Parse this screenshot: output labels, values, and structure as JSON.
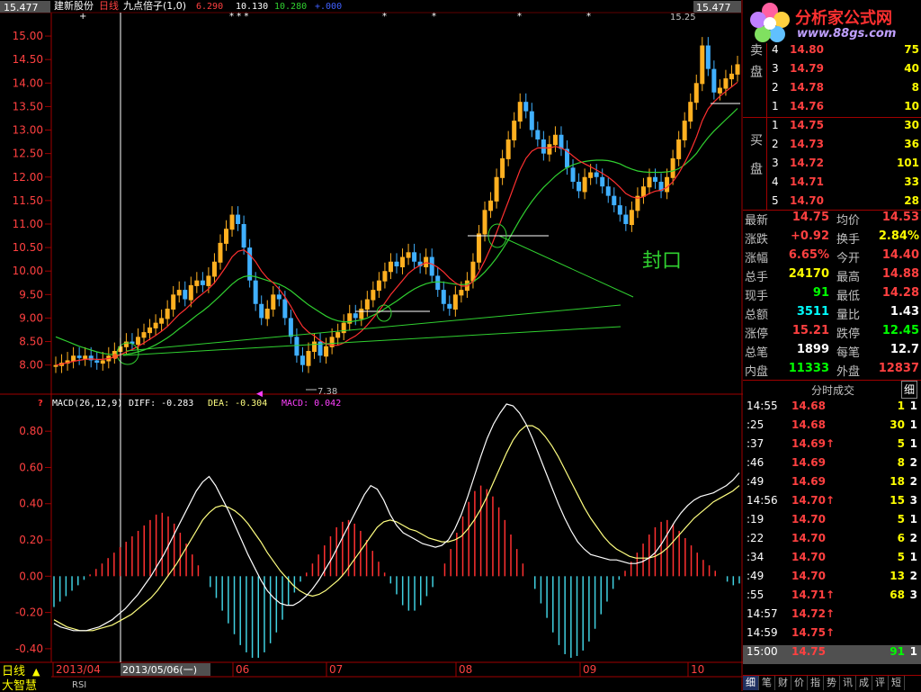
{
  "header": {
    "stock_name": "建新股份",
    "indicator_label": "日线",
    "formula_label": "九点倍子(1,0)",
    "val1": "6.290",
    "val2": "10.130",
    "val3": "10.280",
    "val4": "+.000",
    "top_price_left": "15.477",
    "top_price_right": "15.477",
    "peak_label": "15.25",
    "low_label": "7.38"
  },
  "logo": {
    "title": "分析家公式网",
    "url": "www.88gs.com"
  },
  "annotation": {
    "seal_text": "封口"
  },
  "macd_header": {
    "label": "MACD(26,12,9)",
    "diff": "DIFF: -0.283",
    "dea": "DEA: -0.304",
    "macd": "MACD: 0.042"
  },
  "chart_data": [
    {
      "type": "candlestick",
      "title": "",
      "y_ticks": [
        "15.00",
        "14.50",
        "14.00",
        "13.50",
        "13.00",
        "12.50",
        "12.00",
        "11.50",
        "11.00",
        "10.50",
        "10.00",
        "9.50",
        "9.00",
        "8.50",
        "8.00"
      ],
      "ylim": [
        7.4,
        15.48
      ],
      "x_ticks": [
        "2013/04",
        "06",
        "07",
        "08",
        "09",
        "10"
      ],
      "cursor_date": "2013/05/06(一)",
      "colors": {
        "up": "#ffb020",
        "down": "#40b0ff",
        "ma_short": "#ff3030",
        "ma_long": "#30d030"
      },
      "closes": [
        8.0,
        8.05,
        8.1,
        8.2,
        8.15,
        8.2,
        8.1,
        8.05,
        8.1,
        8.2,
        8.3,
        8.4,
        8.5,
        8.45,
        8.6,
        8.7,
        8.8,
        8.9,
        9.0,
        9.2,
        9.5,
        9.6,
        9.4,
        9.7,
        9.8,
        9.7,
        9.9,
        10.2,
        10.6,
        10.9,
        11.2,
        11.0,
        10.5,
        9.8,
        9.3,
        9.0,
        9.2,
        9.5,
        9.4,
        9.0,
        8.6,
        8.2,
        8.0,
        8.3,
        8.5,
        8.2,
        8.4,
        8.6,
        8.7,
        8.9,
        9.1,
        9.0,
        9.2,
        9.4,
        9.6,
        9.8,
        10.0,
        10.2,
        10.1,
        10.3,
        10.4,
        10.2,
        10.1,
        10.3,
        9.9,
        9.6,
        9.3,
        9.2,
        9.5,
        9.6,
        9.8,
        10.2,
        10.8,
        11.3,
        11.5,
        12.0,
        12.4,
        12.8,
        13.2,
        13.6,
        13.4,
        13.0,
        12.8,
        12.5,
        12.7,
        12.9,
        12.6,
        12.2,
        11.9,
        11.7,
        12.0,
        12.1,
        12.0,
        11.8,
        11.6,
        11.4,
        11.2,
        11.0,
        11.3,
        11.6,
        11.8,
        12.0,
        11.9,
        11.7,
        12.0,
        12.4,
        12.8,
        13.2,
        13.6,
        14.0,
        14.8,
        14.3,
        13.8,
        13.9,
        14.1,
        14.2,
        14.4
      ],
      "ma_short": [
        8.0,
        8.02,
        8.05,
        8.08,
        8.1,
        8.12,
        8.13,
        8.12,
        8.12,
        8.14,
        8.17,
        8.22,
        8.28,
        8.33,
        8.4,
        8.47,
        8.55,
        8.63,
        8.72,
        8.82,
        8.95,
        9.08,
        9.18,
        9.3,
        9.42,
        9.52,
        9.62,
        9.75,
        9.92,
        10.1,
        10.3,
        10.42,
        10.45,
        10.35,
        10.2,
        10.0,
        9.85,
        9.75,
        9.62,
        9.45,
        9.25,
        9.02,
        8.82,
        8.7,
        8.62,
        8.52,
        8.45,
        8.42,
        8.42,
        8.47,
        8.55,
        8.62,
        8.72,
        8.85,
        9.0,
        9.15,
        9.32,
        9.5,
        9.65,
        9.8,
        9.95,
        10.05,
        10.12,
        10.18,
        10.15,
        10.08,
        9.98,
        9.85,
        9.75,
        9.68,
        9.68,
        9.78,
        9.98,
        10.22,
        10.5,
        10.82,
        11.15,
        11.48,
        11.82,
        12.15,
        12.4,
        12.55,
        12.62,
        12.62,
        12.62,
        12.65,
        12.62,
        12.55,
        12.45,
        12.35,
        12.28,
        12.22,
        12.15,
        12.08,
        12.0,
        11.9,
        11.78,
        11.65,
        11.58,
        11.55,
        11.58,
        11.65,
        11.7,
        11.72,
        11.78,
        11.9,
        12.08,
        12.3,
        12.55,
        12.85,
        13.2,
        13.45,
        13.6,
        13.72,
        13.82,
        13.92,
        14.02
      ],
      "ma_long": [
        8.6,
        8.55,
        8.5,
        8.45,
        8.4,
        8.36,
        8.32,
        8.28,
        8.25,
        8.23,
        8.22,
        8.22,
        8.23,
        8.25,
        8.28,
        8.32,
        8.37,
        8.43,
        8.5,
        8.58,
        8.67,
        8.77,
        8.86,
        8.96,
        9.06,
        9.15,
        9.25,
        9.36,
        9.48,
        9.6,
        9.72,
        9.82,
        9.88,
        9.9,
        9.88,
        9.84,
        9.8,
        9.76,
        9.72,
        9.66,
        9.58,
        9.48,
        9.38,
        9.28,
        9.2,
        9.12,
        9.04,
        8.98,
        8.94,
        8.92,
        8.92,
        8.94,
        8.96,
        9.0,
        9.06,
        9.12,
        9.2,
        9.28,
        9.36,
        9.45,
        9.54,
        9.62,
        9.68,
        9.73,
        9.76,
        9.77,
        9.76,
        9.74,
        9.72,
        9.71,
        9.72,
        9.77,
        9.86,
        9.98,
        10.12,
        10.28,
        10.46,
        10.66,
        10.88,
        11.1,
        11.3,
        11.48,
        11.64,
        11.78,
        11.9,
        12.02,
        12.12,
        12.2,
        12.26,
        12.3,
        12.33,
        12.35,
        12.36,
        12.36,
        12.35,
        12.32,
        12.28,
        12.22,
        12.17,
        12.13,
        12.11,
        12.1,
        12.1,
        12.1,
        12.11,
        12.13,
        12.18,
        12.26,
        12.37,
        12.5,
        12.68,
        12.84,
        12.98,
        13.1,
        13.22,
        13.34,
        13.46
      ]
    },
    {
      "type": "bar+line",
      "title": "MACD(26,12,9)",
      "y_ticks": [
        "0.80",
        "0.60",
        "0.40",
        "0.20",
        "0.00",
        "-0.20",
        "-0.40"
      ],
      "ylim": [
        -0.47,
        0.92
      ],
      "colors": {
        "pos": "#ff3030",
        "neg": "#40d0e0",
        "diff": "#ffffff",
        "dea": "#ffff80"
      },
      "histogram": [
        -0.17,
        -0.14,
        -0.11,
        -0.08,
        -0.05,
        -0.02,
        0.01,
        0.04,
        0.07,
        0.1,
        0.13,
        0.16,
        0.19,
        0.22,
        0.25,
        0.28,
        0.31,
        0.34,
        0.35,
        0.33,
        0.29,
        0.24,
        0.18,
        0.12,
        0.06,
        0.0,
        -0.06,
        -0.12,
        -0.19,
        -0.26,
        -0.32,
        -0.38,
        -0.42,
        -0.45,
        -0.45,
        -0.42,
        -0.37,
        -0.31,
        -0.24,
        -0.16,
        -0.09,
        -0.03,
        0.02,
        0.07,
        0.12,
        0.17,
        0.22,
        0.27,
        0.3,
        0.31,
        0.29,
        0.25,
        0.2,
        0.14,
        0.08,
        0.02,
        -0.04,
        -0.1,
        -0.16,
        -0.19,
        -0.19,
        -0.16,
        -0.11,
        -0.06,
        0.0,
        0.07,
        0.15,
        0.24,
        0.33,
        0.41,
        0.47,
        0.5,
        0.48,
        0.44,
        0.38,
        0.31,
        0.23,
        0.15,
        0.07,
        0.0,
        -0.07,
        -0.15,
        -0.23,
        -0.31,
        -0.38,
        -0.43,
        -0.45,
        -0.44,
        -0.41,
        -0.36,
        -0.29,
        -0.21,
        -0.14,
        -0.07,
        -0.02,
        0.03,
        0.08,
        0.13,
        0.18,
        0.23,
        0.27,
        0.3,
        0.31,
        0.29,
        0.25,
        0.21,
        0.17,
        0.13,
        0.09,
        0.06,
        0.03,
        0.0,
        -0.03,
        -0.05,
        -0.04
      ],
      "diff": [
        -0.26,
        -0.28,
        -0.29,
        -0.3,
        -0.3,
        -0.3,
        -0.29,
        -0.28,
        -0.26,
        -0.24,
        -0.21,
        -0.18,
        -0.14,
        -0.1,
        -0.05,
        0.0,
        0.06,
        0.12,
        0.19,
        0.26,
        0.33,
        0.4,
        0.47,
        0.52,
        0.55,
        0.5,
        0.43,
        0.36,
        0.28,
        0.2,
        0.12,
        0.05,
        -0.02,
        -0.08,
        -0.12,
        -0.15,
        -0.16,
        -0.16,
        -0.14,
        -0.11,
        -0.07,
        -0.02,
        0.04,
        0.1,
        0.17,
        0.24,
        0.31,
        0.38,
        0.45,
        0.5,
        0.48,
        0.42,
        0.34,
        0.28,
        0.24,
        0.22,
        0.2,
        0.18,
        0.17,
        0.16,
        0.17,
        0.2,
        0.26,
        0.34,
        0.44,
        0.55,
        0.66,
        0.76,
        0.84,
        0.9,
        0.95,
        0.94,
        0.9,
        0.84,
        0.76,
        0.67,
        0.58,
        0.49,
        0.4,
        0.32,
        0.25,
        0.19,
        0.15,
        0.12,
        0.11,
        0.1,
        0.09,
        0.09,
        0.08,
        0.07,
        0.07,
        0.08,
        0.1,
        0.13,
        0.18,
        0.24,
        0.3,
        0.35,
        0.39,
        0.42,
        0.44,
        0.45,
        0.46,
        0.48,
        0.5,
        0.53,
        0.57
      ],
      "dea": [
        -0.24,
        -0.26,
        -0.28,
        -0.29,
        -0.3,
        -0.3,
        -0.3,
        -0.29,
        -0.28,
        -0.27,
        -0.25,
        -0.23,
        -0.21,
        -0.18,
        -0.15,
        -0.12,
        -0.08,
        -0.03,
        0.02,
        0.07,
        0.13,
        0.19,
        0.25,
        0.31,
        0.35,
        0.38,
        0.39,
        0.38,
        0.36,
        0.33,
        0.29,
        0.24,
        0.19,
        0.13,
        0.08,
        0.03,
        -0.01,
        -0.05,
        -0.08,
        -0.1,
        -0.11,
        -0.1,
        -0.08,
        -0.05,
        -0.02,
        0.02,
        0.07,
        0.12,
        0.17,
        0.22,
        0.27,
        0.3,
        0.31,
        0.3,
        0.28,
        0.26,
        0.25,
        0.23,
        0.21,
        0.2,
        0.19,
        0.19,
        0.2,
        0.22,
        0.26,
        0.31,
        0.37,
        0.44,
        0.52,
        0.6,
        0.68,
        0.75,
        0.8,
        0.83,
        0.83,
        0.81,
        0.77,
        0.72,
        0.66,
        0.59,
        0.52,
        0.45,
        0.38,
        0.32,
        0.27,
        0.22,
        0.18,
        0.15,
        0.13,
        0.11,
        0.1,
        0.1,
        0.1,
        0.11,
        0.13,
        0.16,
        0.2,
        0.24,
        0.28,
        0.32,
        0.35,
        0.38,
        0.41,
        0.43,
        0.45,
        0.47,
        0.5
      ]
    }
  ],
  "order_book": {
    "sell_label": "卖盘",
    "buy_label": "买盘",
    "sells": [
      {
        "idx": "4",
        "price": "14.80",
        "vol": "75"
      },
      {
        "idx": "3",
        "price": "14.79",
        "vol": "40"
      },
      {
        "idx": "2",
        "price": "14.78",
        "vol": "8"
      },
      {
        "idx": "1",
        "price": "14.76",
        "vol": "10"
      }
    ],
    "buys": [
      {
        "idx": "1",
        "price": "14.75",
        "vol": "30"
      },
      {
        "idx": "2",
        "price": "14.73",
        "vol": "36"
      },
      {
        "idx": "3",
        "price": "14.72",
        "vol": "101"
      },
      {
        "idx": "4",
        "price": "14.71",
        "vol": "33"
      },
      {
        "idx": "5",
        "price": "14.70",
        "vol": "28"
      }
    ]
  },
  "quote": [
    {
      "l": "最新",
      "v": "14.75",
      "vc": "#ff4040",
      "l2": "均价",
      "v2": "14.53",
      "v2c": "#ff4040"
    },
    {
      "l": "涨跌",
      "v": "+0.92",
      "vc": "#ff4040",
      "l2": "换手",
      "v2": "2.84%",
      "v2c": "#ffff00"
    },
    {
      "l": "涨幅",
      "v": "6.65%",
      "vc": "#ff4040",
      "l2": "今开",
      "v2": "14.40",
      "v2c": "#ff4040"
    },
    {
      "l": "总手",
      "v": "24170",
      "vc": "#ffff00",
      "l2": "最高",
      "v2": "14.88",
      "v2c": "#ff4040"
    },
    {
      "l": "现手",
      "v": "91",
      "vc": "#00ff00",
      "l2": "最低",
      "v2": "14.28",
      "v2c": "#ff4040"
    },
    {
      "l": "总额",
      "v": "3511",
      "vc": "#00ffff",
      "l2": "量比",
      "v2": "1.43",
      "v2c": "#ffffff"
    },
    {
      "l": "涨停",
      "v": "15.21",
      "vc": "#ff4040",
      "l2": "跌停",
      "v2": "12.45",
      "v2c": "#00ff00"
    },
    {
      "l": "总笔",
      "v": "1899",
      "vc": "#ffffff",
      "l2": "每笔",
      "v2": "12.7",
      "v2c": "#ffffff"
    },
    {
      "l": "内盘",
      "v": "11333",
      "vc": "#00ff00",
      "l2": "外盘",
      "v2": "12837",
      "v2c": "#ff4040"
    }
  ],
  "ticks_panel": {
    "title": "分时成交",
    "detail_btn": "细"
  },
  "ticks": [
    {
      "t": "14:55",
      "p": "14.68",
      "up": false,
      "v": "1",
      "f": "1"
    },
    {
      "t": ":25",
      "p": "14.68",
      "up": false,
      "v": "30",
      "f": "1"
    },
    {
      "t": ":37",
      "p": "14.69",
      "up": true,
      "v": "5",
      "f": "1"
    },
    {
      "t": ":46",
      "p": "14.69",
      "up": false,
      "v": "8",
      "f": "2"
    },
    {
      "t": ":49",
      "p": "14.69",
      "up": false,
      "v": "18",
      "f": "2"
    },
    {
      "t": "14:56",
      "p": "14.70",
      "up": true,
      "v": "15",
      "f": "3"
    },
    {
      "t": ":19",
      "p": "14.70",
      "up": false,
      "v": "5",
      "f": "1"
    },
    {
      "t": ":22",
      "p": "14.70",
      "up": false,
      "v": "6",
      "f": "2"
    },
    {
      "t": ":34",
      "p": "14.70",
      "up": false,
      "v": "5",
      "f": "1"
    },
    {
      "t": ":49",
      "p": "14.70",
      "up": false,
      "v": "13",
      "f": "2"
    },
    {
      "t": ":55",
      "p": "14.71",
      "up": true,
      "v": "68",
      "f": "3"
    },
    {
      "t": "14:57",
      "p": "14.72",
      "up": true,
      "v": "",
      "f": ""
    },
    {
      "t": "14:59",
      "p": "14.75",
      "up": true,
      "v": "",
      "f": ""
    },
    {
      "t": "15:00",
      "p": "14.75",
      "up": false,
      "v": "91",
      "f": "1"
    }
  ],
  "bottom": {
    "period": "日线",
    "brand": "大智慧",
    "sub_tab": "RSI",
    "right_tabs": [
      "细",
      "笔",
      "财",
      "价",
      "指",
      "势",
      "讯",
      "成",
      "评",
      "短"
    ]
  }
}
